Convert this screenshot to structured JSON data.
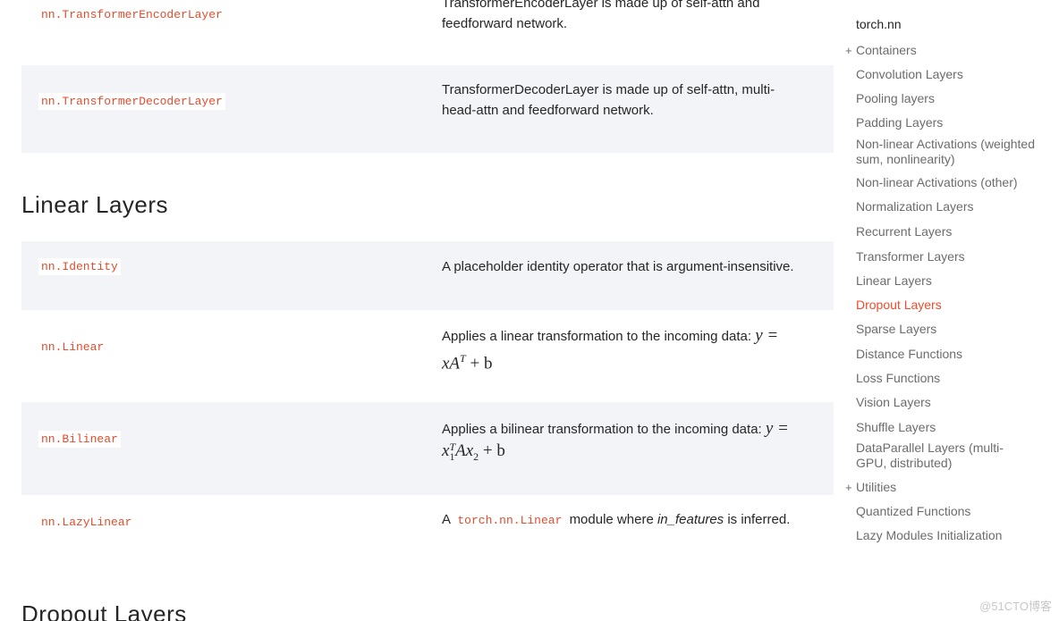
{
  "prev_section_rows": [
    {
      "name": "nn.TransformerEncoderLayer",
      "desc_line1": "TransformerEncoderLayer is made up of self-attn and",
      "desc_line2": "feedforward network."
    },
    {
      "name": "nn.TransformerDecoderLayer",
      "desc_line1": "TransformerDecoderLayer is made up of self-attn, multi-",
      "desc_line2": "head-attn and feedforward network."
    }
  ],
  "linear_section": {
    "title": "Linear Layers",
    "rows": [
      {
        "name": "nn.Identity",
        "desc": "A placeholder identity operator that is argument-insensitive."
      },
      {
        "name": "nn.Linear",
        "desc_text": "Applies a linear transformation to the incoming data: ",
        "math_line1": "y =",
        "math_line2_a": "xA",
        "math_line2_sup": "T",
        "math_line2_b": " + b"
      },
      {
        "name": "nn.Bilinear",
        "desc_text": "Applies a bilinear transformation to the incoming data: ",
        "math_line1": "y =",
        "math_line2_x": "x",
        "math_line2_sup": "T",
        "math_line2_sub": "1",
        "math_line2_a": "Ax",
        "math_line2_sub2": "2",
        "math_line2_b": " + b"
      },
      {
        "name": "nn.LazyLinear",
        "desc_pre": "A",
        "desc_code": "torch.nn.Linear",
        "desc_mid": "module where ",
        "desc_em": "in_features",
        "desc_post": " is inferred."
      }
    ]
  },
  "next_section": {
    "title": "Dropout Layers"
  },
  "sidebar": {
    "title": "torch.nn",
    "items": [
      {
        "label": "Containers",
        "expandable": true
      },
      {
        "label": "Convolution Layers"
      },
      {
        "label": "Pooling layers"
      },
      {
        "label": "Padding Layers"
      },
      {
        "label": "Non-linear Activations (weighted sum, nonlinearity)"
      },
      {
        "label": "Non-linear Activations (other)"
      },
      {
        "label": "Normalization Layers"
      },
      {
        "label": "Recurrent Layers"
      },
      {
        "label": "Transformer Layers"
      },
      {
        "label": "Linear Layers"
      },
      {
        "label": "Dropout Layers",
        "active": true
      },
      {
        "label": "Sparse Layers"
      },
      {
        "label": "Distance Functions"
      },
      {
        "label": "Loss Functions"
      },
      {
        "label": "Vision Layers"
      },
      {
        "label": "Shuffle Layers"
      },
      {
        "label": "DataParallel Layers (multi-GPU, distributed)"
      },
      {
        "label": "Utilities",
        "expandable": true
      },
      {
        "label": "Quantized Functions"
      },
      {
        "label": "Lazy Modules Initialization"
      }
    ],
    "expand_glyph": "+"
  },
  "watermark": "@51CTO博客",
  "colors": {
    "accent": "#ee4c2c",
    "row_shade": "#f3f4f7",
    "text": "#262626",
    "sidebar_text": "#6c6c6d"
  }
}
